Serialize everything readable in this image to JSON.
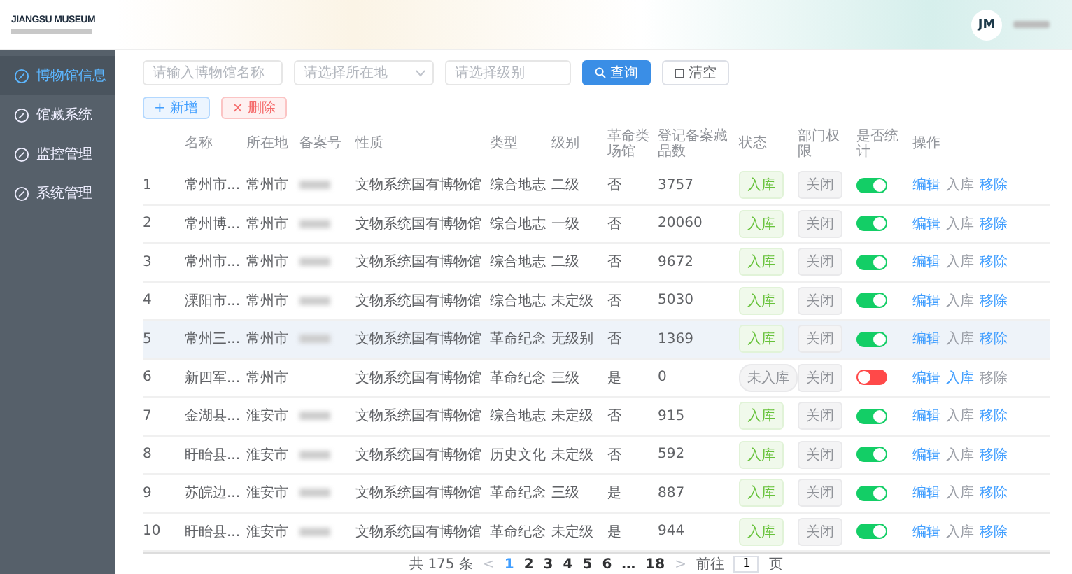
{
  "logo": {
    "title": "JIANGSU MUSEUM"
  },
  "header": {
    "avatar": "JM",
    "user_name_redacted": true
  },
  "sidebar": {
    "items": [
      {
        "label": "博物馆信息",
        "selected": true
      },
      {
        "label": "馆藏系统",
        "selected": false
      },
      {
        "label": "监控管理",
        "selected": false
      },
      {
        "label": "系统管理",
        "selected": false
      }
    ]
  },
  "filters": {
    "name": {
      "placeholder": "请输入博物馆名称"
    },
    "location": {
      "placeholder": "请选择所在地"
    },
    "level": {
      "placeholder": "请选择级别"
    },
    "search_button": "查询",
    "clear_button": "清空"
  },
  "actions": [
    {
      "label": "新增",
      "kind": "primary",
      "icon": "+"
    },
    {
      "label": "删除",
      "kind": "danger",
      "icon": "×"
    }
  ],
  "table": {
    "columns": [
      "",
      "名称",
      "所在地",
      "备案号",
      "性质",
      "类型",
      "级别",
      "革命类场馆",
      "登记备案藏品数",
      "状态",
      "部门权限",
      "是否统计",
      "操作"
    ],
    "rows": [
      {
        "index": "1",
        "name": "常州市...",
        "location": "常州市",
        "record_redacted": true,
        "nature": "文物系统国有博物馆",
        "type": "综合地志",
        "level": "二级",
        "revolutionary": "否",
        "count": "3757",
        "status": {
          "text": "入库",
          "kind": "success"
        },
        "permission": "关闭",
        "counted": true,
        "selected": false,
        "ops": [
          {
            "label": "编辑",
            "disabled": false
          },
          {
            "label": "入库",
            "disabled": true
          },
          {
            "label": "移除",
            "disabled": false
          }
        ]
      },
      {
        "index": "2",
        "name": "常州博...",
        "location": "常州市",
        "record_redacted": true,
        "nature": "文物系统国有博物馆",
        "type": "综合地志",
        "level": "一级",
        "revolutionary": "否",
        "count": "20060",
        "status": {
          "text": "入库",
          "kind": "success"
        },
        "permission": "关闭",
        "counted": true,
        "selected": false,
        "ops": [
          {
            "label": "编辑",
            "disabled": false
          },
          {
            "label": "入库",
            "disabled": true
          },
          {
            "label": "移除",
            "disabled": false
          }
        ]
      },
      {
        "index": "3",
        "name": "常州市...",
        "location": "常州市",
        "record_redacted": true,
        "nature": "文物系统国有博物馆",
        "type": "综合地志",
        "level": "二级",
        "revolutionary": "否",
        "count": "9672",
        "status": {
          "text": "入库",
          "kind": "success"
        },
        "permission": "关闭",
        "counted": true,
        "selected": false,
        "ops": [
          {
            "label": "编辑",
            "disabled": false
          },
          {
            "label": "入库",
            "disabled": true
          },
          {
            "label": "移除",
            "disabled": false
          }
        ]
      },
      {
        "index": "4",
        "name": "溧阳市...",
        "location": "常州市",
        "record_redacted": true,
        "nature": "文物系统国有博物馆",
        "type": "综合地志",
        "level": "未定级",
        "revolutionary": "否",
        "count": "5030",
        "status": {
          "text": "入库",
          "kind": "success"
        },
        "permission": "关闭",
        "counted": true,
        "selected": false,
        "ops": [
          {
            "label": "编辑",
            "disabled": false
          },
          {
            "label": "入库",
            "disabled": true
          },
          {
            "label": "移除",
            "disabled": false
          }
        ]
      },
      {
        "index": "5",
        "name": "常州三...",
        "location": "常州市",
        "record_redacted": true,
        "nature": "文物系统国有博物馆",
        "type": "革命纪念",
        "level": "无级别",
        "revolutionary": "否",
        "count": "1369",
        "status": {
          "text": "入库",
          "kind": "success"
        },
        "permission": "关闭",
        "counted": true,
        "selected": true,
        "ops": [
          {
            "label": "编辑",
            "disabled": false
          },
          {
            "label": "入库",
            "disabled": true
          },
          {
            "label": "移除",
            "disabled": false
          }
        ]
      },
      {
        "index": "6",
        "name": "新四军...",
        "location": "常州市",
        "record_redacted": false,
        "nature": "文物系统国有博物馆",
        "type": "革命纪念",
        "level": "三级",
        "revolutionary": "是",
        "count": "0",
        "status": {
          "text": "未入库",
          "kind": "info"
        },
        "permission": "关闭",
        "counted": false,
        "selected": false,
        "ops": [
          {
            "label": "编辑",
            "disabled": false
          },
          {
            "label": "入库",
            "disabled": false
          },
          {
            "label": "移除",
            "disabled": true
          }
        ]
      },
      {
        "index": "7",
        "name": "金湖县...",
        "location": "淮安市",
        "record_redacted": true,
        "nature": "文物系统国有博物馆",
        "type": "综合地志",
        "level": "未定级",
        "revolutionary": "否",
        "count": "915",
        "status": {
          "text": "入库",
          "kind": "success"
        },
        "permission": "关闭",
        "counted": true,
        "selected": false,
        "ops": [
          {
            "label": "编辑",
            "disabled": false
          },
          {
            "label": "入库",
            "disabled": true
          },
          {
            "label": "移除",
            "disabled": false
          }
        ]
      },
      {
        "index": "8",
        "name": "盱眙县...",
        "location": "淮安市",
        "record_redacted": true,
        "nature": "文物系统国有博物馆",
        "type": "历史文化",
        "level": "未定级",
        "revolutionary": "否",
        "count": "592",
        "status": {
          "text": "入库",
          "kind": "success"
        },
        "permission": "关闭",
        "counted": true,
        "selected": false,
        "ops": [
          {
            "label": "编辑",
            "disabled": false
          },
          {
            "label": "入库",
            "disabled": true
          },
          {
            "label": "移除",
            "disabled": false
          }
        ]
      },
      {
        "index": "9",
        "name": "苏皖边...",
        "location": "淮安市",
        "record_redacted": true,
        "nature": "文物系统国有博物馆",
        "type": "革命纪念",
        "level": "三级",
        "revolutionary": "是",
        "count": "887",
        "status": {
          "text": "入库",
          "kind": "success"
        },
        "permission": "关闭",
        "counted": true,
        "selected": false,
        "ops": [
          {
            "label": "编辑",
            "disabled": false
          },
          {
            "label": "入库",
            "disabled": true
          },
          {
            "label": "移除",
            "disabled": false
          }
        ]
      },
      {
        "index": "10",
        "name": "盱眙县...",
        "location": "淮安市",
        "record_redacted": true,
        "nature": "文物系统国有博物馆",
        "type": "革命纪念",
        "level": "未定级",
        "revolutionary": "是",
        "count": "944",
        "status": {
          "text": "入库",
          "kind": "success"
        },
        "permission": "关闭",
        "counted": true,
        "selected": false,
        "ops": [
          {
            "label": "编辑",
            "disabled": false
          },
          {
            "label": "入库",
            "disabled": true
          },
          {
            "label": "移除",
            "disabled": false
          }
        ]
      }
    ]
  },
  "pagination": {
    "total": "共 175 条",
    "prev": "<",
    "pages": [
      {
        "label": "1",
        "selected": true
      },
      {
        "label": "2",
        "selected": false
      },
      {
        "label": "3",
        "selected": false
      },
      {
        "label": "4",
        "selected": false
      },
      {
        "label": "5",
        "selected": false
      },
      {
        "label": "6",
        "selected": false
      },
      {
        "label": "…",
        "selected": false
      },
      {
        "label": "18",
        "selected": false
      }
    ],
    "next": ">",
    "goto": "前往",
    "page_value": "1",
    "page_suffix": "页"
  }
}
